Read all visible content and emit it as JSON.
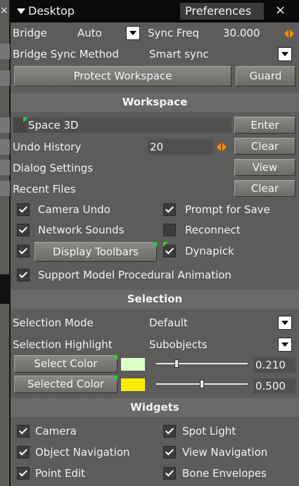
{
  "window": {
    "title": "Desktop",
    "tab": "Preferences",
    "close_glyph": "×"
  },
  "bridge": {
    "label": "Bridge",
    "value": "Auto",
    "sync_freq_label": "Sync Freq",
    "sync_freq_value": "30.000"
  },
  "bridge_sync": {
    "label": "Bridge Sync Method",
    "value": "Smart sync"
  },
  "protect": {
    "label": "Protect Workspace",
    "guard": "Guard"
  },
  "workspace": {
    "title": "Workspace",
    "space3d": {
      "label": "Space 3D",
      "button": "Enter"
    },
    "undo": {
      "label": "Undo History",
      "value": "20",
      "button": "Clear"
    },
    "dialog": {
      "label": "Dialog Settings",
      "button": "View"
    },
    "recent": {
      "label": "Recent Files",
      "button": "Clear"
    },
    "checks": {
      "camera_undo": {
        "label": "Camera Undo",
        "checked": true
      },
      "prompt_save": {
        "label": "Prompt for Save",
        "checked": true
      },
      "network_sounds": {
        "label": "Network Sounds",
        "checked": true
      },
      "reconnect": {
        "label": "Reconnect",
        "checked": false
      },
      "display_toolbars": {
        "label": "Display Toolbars",
        "checked": true
      },
      "dynapick": {
        "label": "Dynapick",
        "checked": true
      },
      "procedural": {
        "label": "Support Model Procedural Animation",
        "checked": true
      }
    }
  },
  "selection": {
    "title": "Selection",
    "mode": {
      "label": "Selection Mode",
      "value": "Default"
    },
    "highlight": {
      "label": "Selection Highlight",
      "value": "Subobjects"
    },
    "select_color": {
      "label": "Select Color",
      "swatch": "#ddffc9",
      "value": "0.210",
      "level": 0.21
    },
    "selected_color": {
      "label": "Selected Color",
      "swatch": "#ffee00",
      "value": "0.500",
      "level": 0.5
    }
  },
  "widgets": {
    "title": "Widgets",
    "items": [
      {
        "label": "Camera",
        "checked": true
      },
      {
        "label": "Spot Light",
        "checked": true
      },
      {
        "label": "Object Navigation",
        "checked": true
      },
      {
        "label": "View Navigation",
        "checked": true
      },
      {
        "label": "Point Edit",
        "checked": true
      },
      {
        "label": "Bone Envelopes",
        "checked": true
      }
    ]
  },
  "colors": {
    "accent": "#ff8c00",
    "marker": "#26d13f"
  }
}
